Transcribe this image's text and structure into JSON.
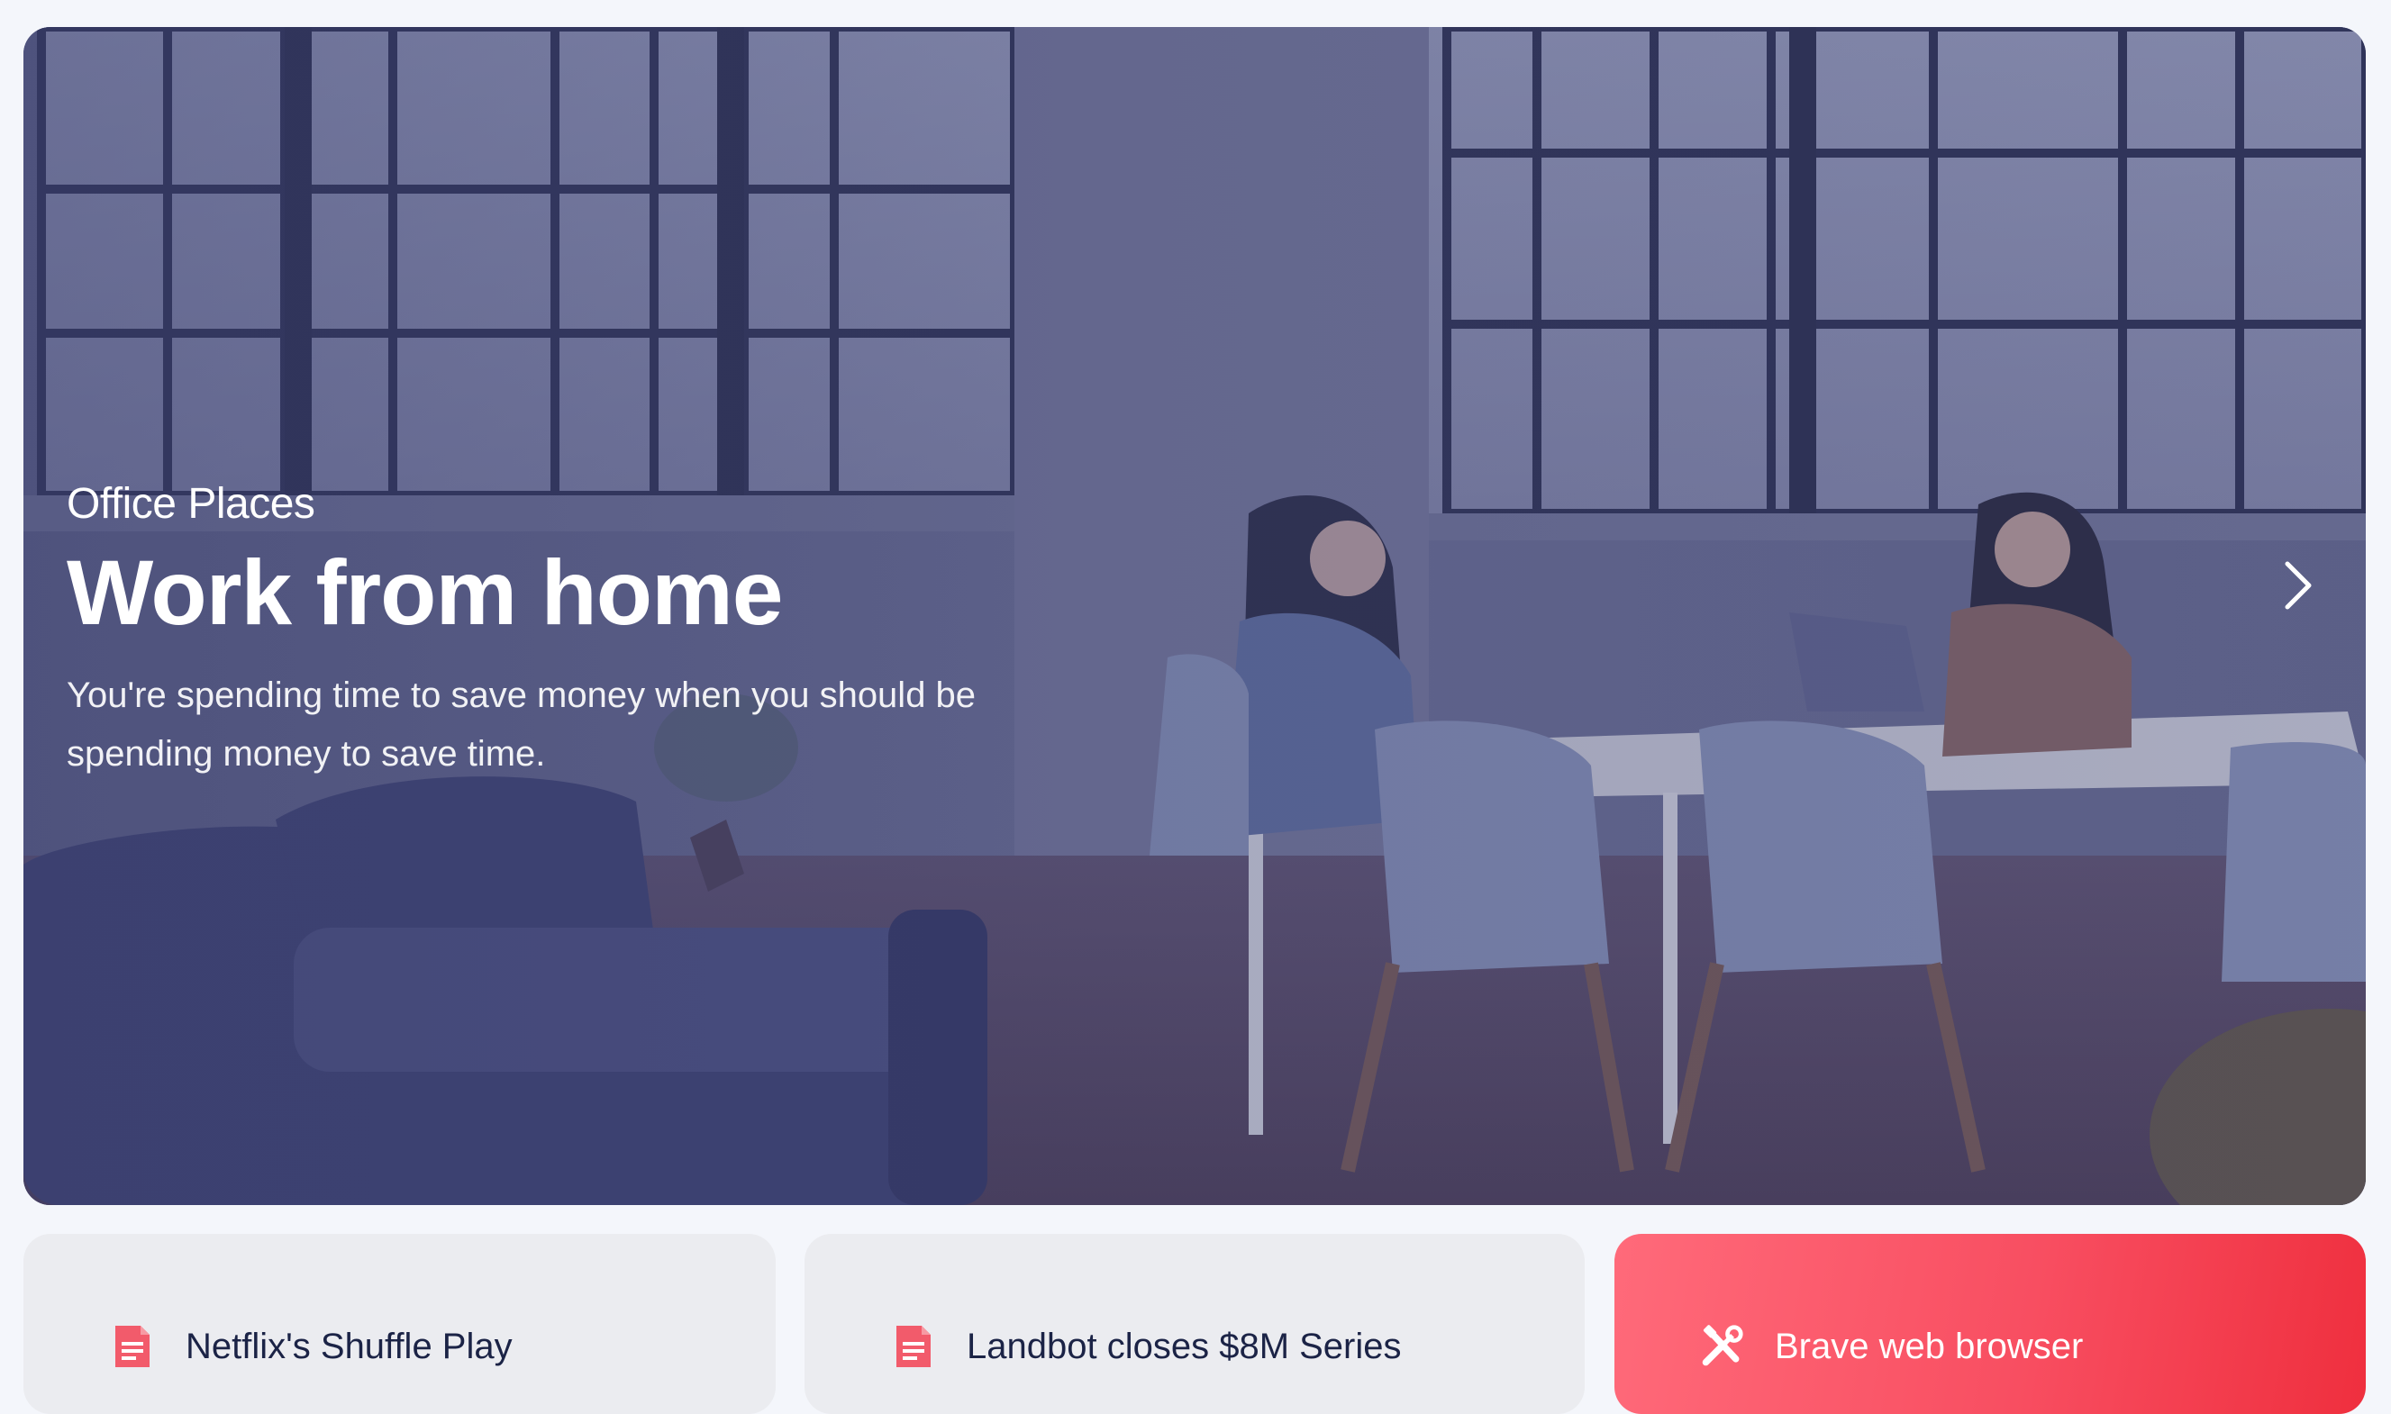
{
  "hero": {
    "category": "Office Places",
    "title": "Work from home",
    "description": "You're spending time to save money when you should be spending money to save time."
  },
  "cards": [
    {
      "title": "Netflix's Shuffle Play",
      "icon": "document-icon",
      "accent": "#f25b6b"
    },
    {
      "title": "Landbot closes $8M Series",
      "icon": "document-icon",
      "accent": "#f25b6b"
    },
    {
      "title": "Brave web browser",
      "icon": "tools-icon",
      "accent": "#ffffff"
    }
  ]
}
